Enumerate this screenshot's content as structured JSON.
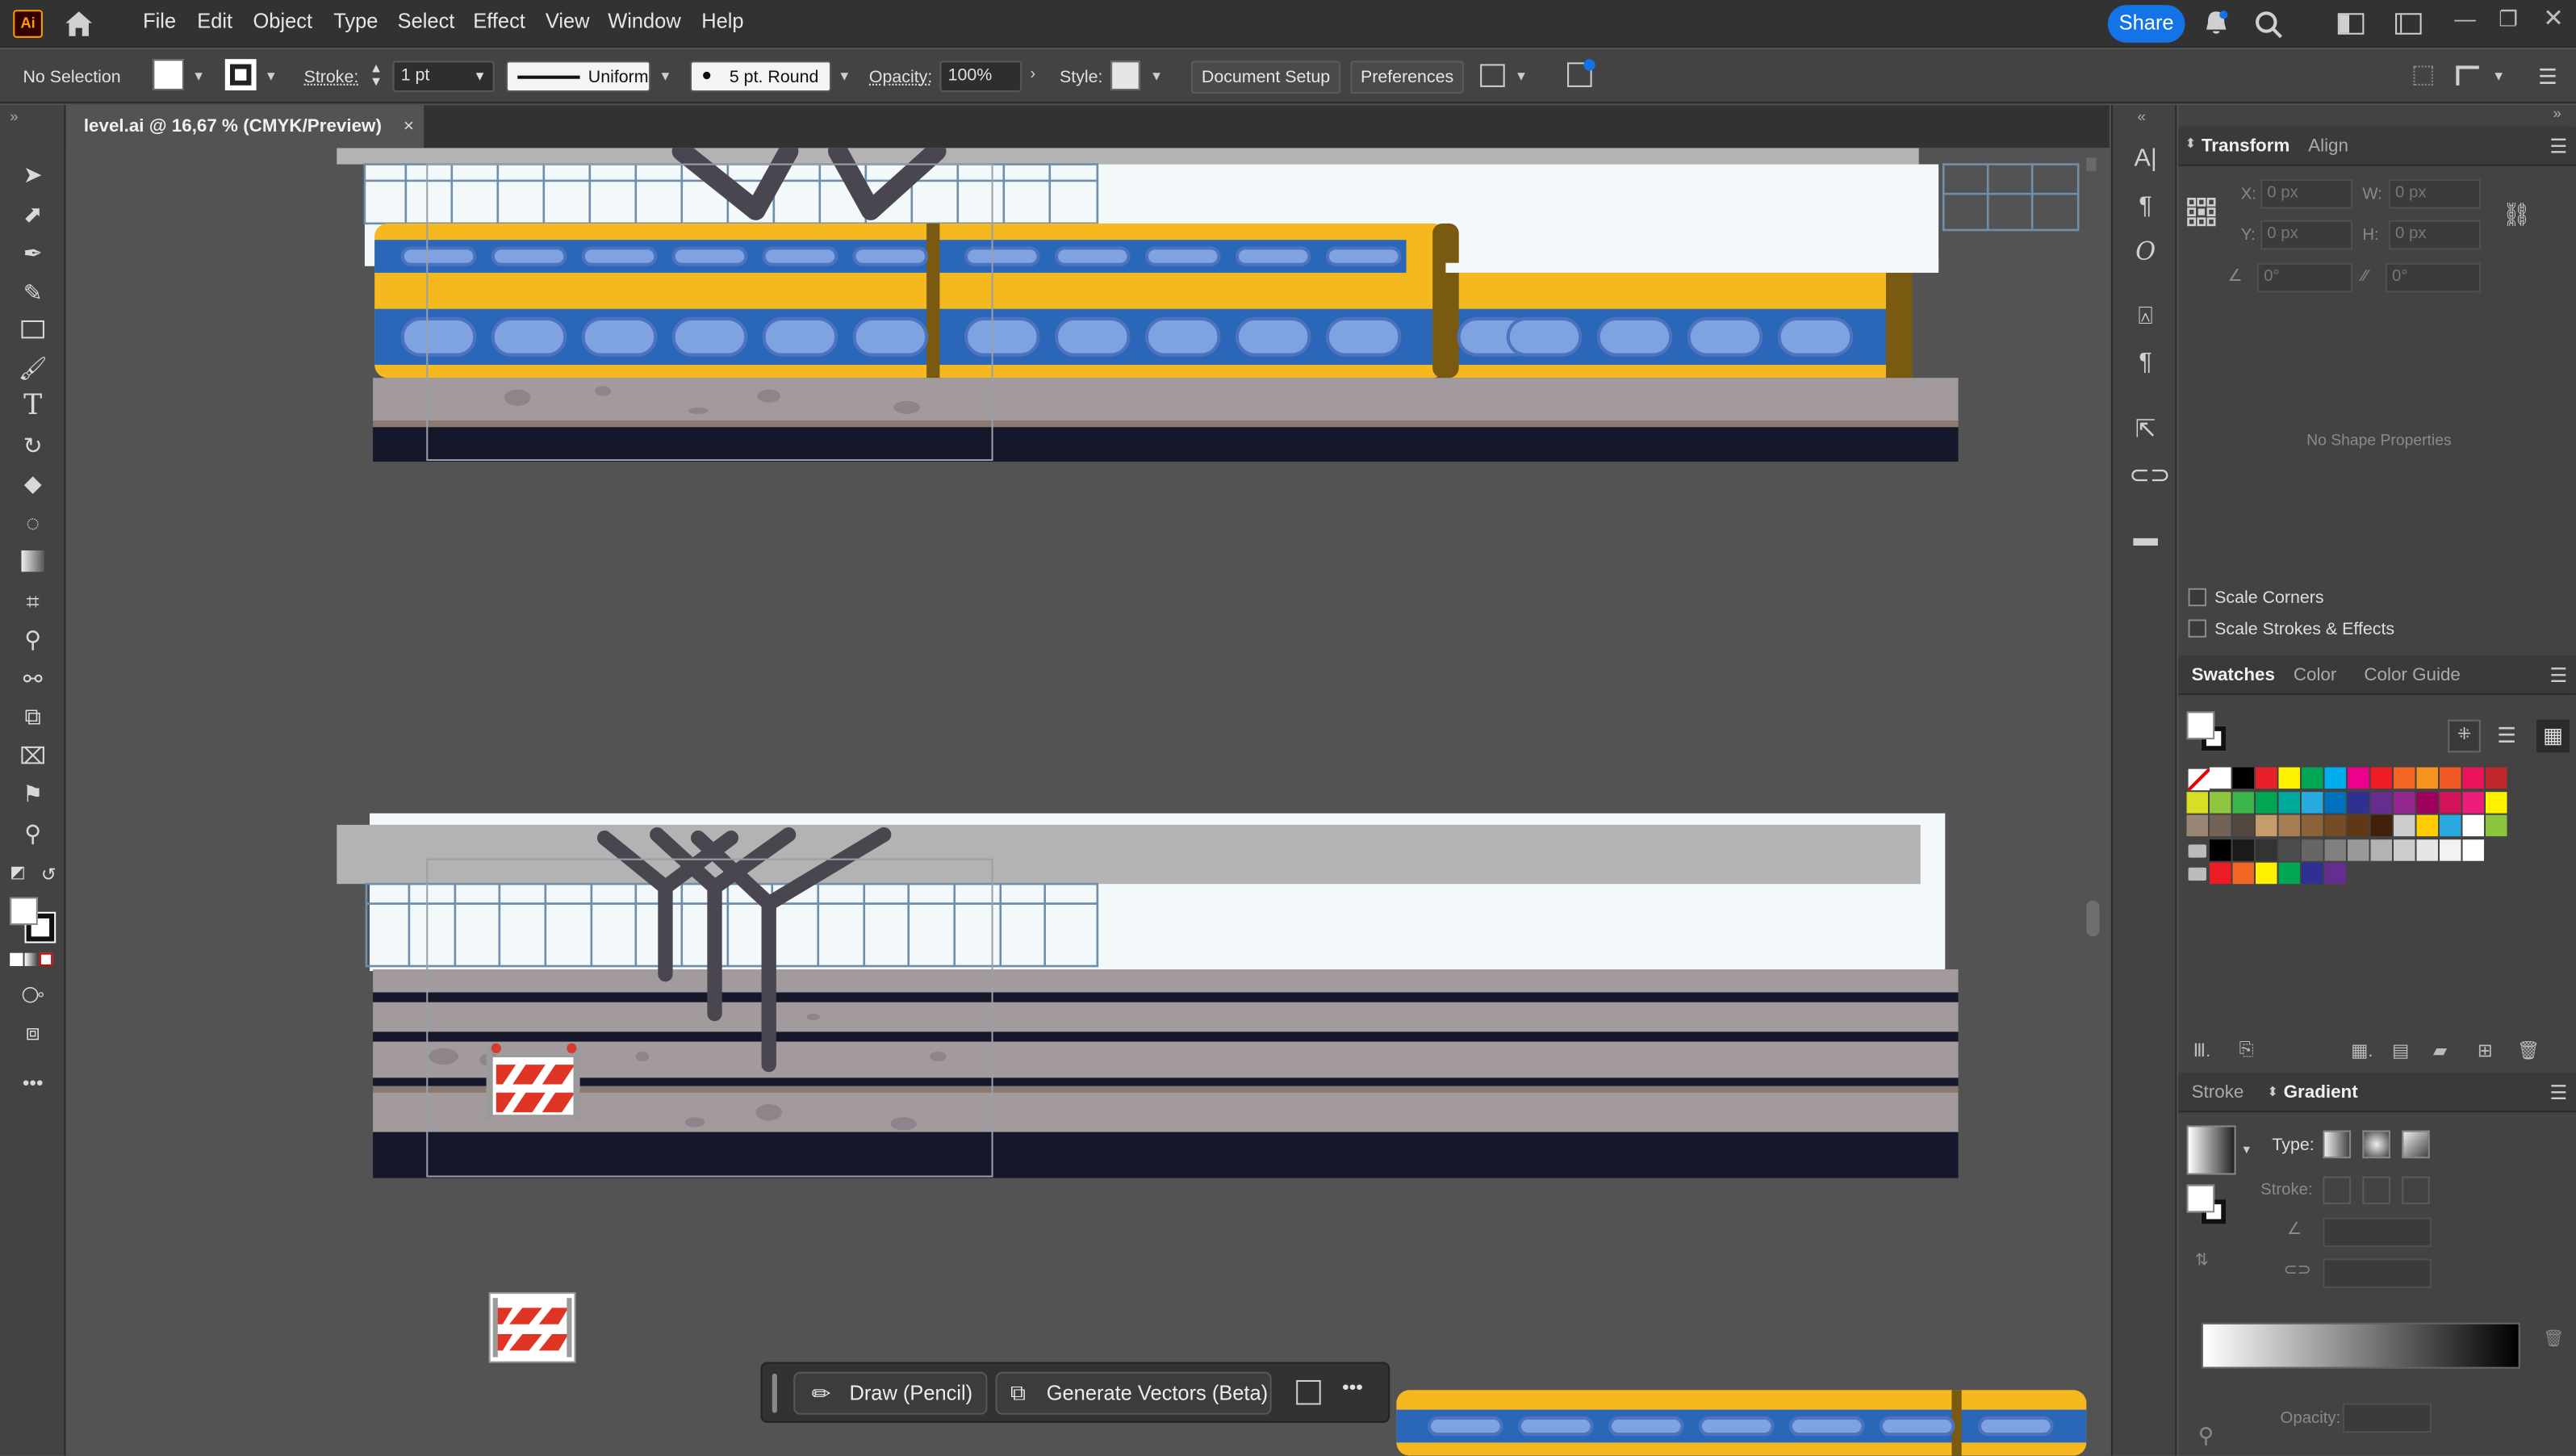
{
  "app": {
    "logo": "Ai",
    "menu": [
      "File",
      "Edit",
      "Object",
      "Type",
      "Select",
      "Effect",
      "View",
      "Window",
      "Help"
    ],
    "share": "Share"
  },
  "control": {
    "selection": "No Selection",
    "stroke_label": "Stroke:",
    "stroke_weight": "1 pt",
    "profile": "Uniform",
    "brush": "5 pt. Round",
    "opacity_label": "Opacity:",
    "opacity": "100%",
    "style_label": "Style:",
    "document_setup": "Document Setup",
    "preferences": "Preferences"
  },
  "document": {
    "tab_title": "level.ai @ 16,67 % (CMYK/Preview)",
    "close": "×"
  },
  "transform": {
    "tabs": [
      "Transform",
      "Align"
    ],
    "x_label": "X:",
    "x": "0 px",
    "w_label": "W:",
    "w": "0 px",
    "y_label": "Y:",
    "y": "0 px",
    "h_label": "H:",
    "h": "0 px",
    "angle": "0°",
    "shear": "0°",
    "empty_message": "No Shape Properties",
    "scale_corners": "Scale Corners",
    "scale_strokes": "Scale Strokes & Effects"
  },
  "swatches": {
    "tabs": [
      "Swatches",
      "Color",
      "Color Guide"
    ],
    "rows": [
      [
        "#ffffff",
        "#ffffff",
        "#000000",
        "#e8202a",
        "#fff200",
        "#00a651",
        "#00aeef",
        "#ec008c",
        "#ed1c24",
        "#f26522",
        "#f7941d",
        "#f15a24",
        "#ed145b",
        "#c1272d"
      ],
      [
        "#d7df23",
        "#8dc63f",
        "#39b54a",
        "#00a651",
        "#00a99d",
        "#29abe2",
        "#0071bc",
        "#2e3192",
        "#662d91",
        "#92278f",
        "#9e005d",
        "#d4145a",
        "#ed1e79",
        "#fff200"
      ],
      [
        "#998675",
        "#736357",
        "#534741",
        "#c69c6d",
        "#a67c52",
        "#8c6239",
        "#754c24",
        "#603813",
        "#42210b",
        "#cccccc",
        "#ffcc00",
        "#29abe2",
        "#ffffff",
        "#8cc63f"
      ],
      [
        "#000000",
        "#1a1a1a",
        "#333333",
        "#4d4d4d",
        "#666666",
        "#808080",
        "#999999",
        "#b3b3b3",
        "#cccccc",
        "#e6e6e6",
        "#f2f2f2",
        "#ffffff"
      ],
      [
        "#ed1c24",
        "#f26522",
        "#fff200",
        "#00a651",
        "#2e3192",
        "#662d91"
      ]
    ]
  },
  "gradient": {
    "tabs": [
      "Stroke",
      "Gradient"
    ],
    "type_label": "Type:",
    "stroke_label": "Stroke:",
    "opacity_label": "Opacity:"
  },
  "context_bar": {
    "draw": "Draw (Pencil)",
    "generate": "Generate Vectors (Beta)",
    "more": "•••"
  },
  "colors": {
    "accent": "#1473e6",
    "train_yellow": "#f5b81e",
    "train_blue": "#2a67b8",
    "platform": "#a39a9e",
    "track": "#15182b"
  }
}
